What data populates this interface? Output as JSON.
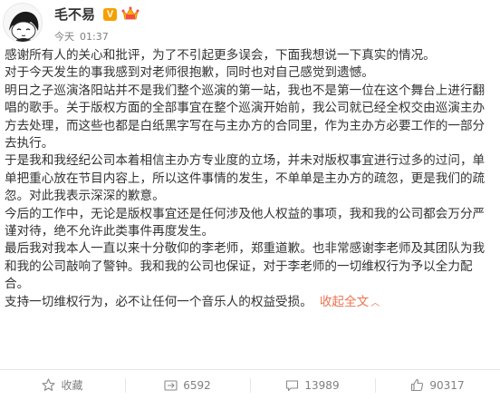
{
  "post": {
    "username": "毛不易",
    "verified_badge": "V",
    "meta": {
      "date": "今天",
      "time": "01:37"
    },
    "paragraphs": [
      "感谢所有人的关心和批评，为了不引起更多误会，下面我想说一下真实的情况。\n对于今天发生的事我感到对老师很抱歉，同时也对自己感觉到遗憾。",
      "明日之子巡演洛阳站并不是我们整个巡演的第一站，我也不是第一位在这个舞台上进行翻唱的歌手。关于版权方面的全部事宜在整个巡演开始前，我公司就已经全权交由巡演主办方去处理，而这些也都是白纸黑字写在与主办方的合同里，作为主办方必要工作的一部分去执行。",
      "于是我和我经纪公司本着相信主办方专业度的立场，并未对版权事宜进行过多的过问，单单把重心放在节目内容上，所以这件事情的发生，不单单是主办方的疏忽，更是我们的疏忽。对此我表示深深的歉意。",
      "今后的工作中，无论是版权事宜还是任何涉及他人权益的事项，我和我的公司都会万分严谨对待，绝不允许此类事件再度发生。",
      "最后我对我本人一直以来十分敬仰的李老师，郑重道歉。也非常感谢李老师及其团队为我和我的公司敲响了警钟。我和我的公司也保证，对于李老师的一切维权行为予以全力配合。"
    ],
    "last_line": "支持一切维权行为，必不让任何一个音乐人的权益受损。",
    "collapse_label": "收起全文",
    "collapse_arrow": "︿"
  },
  "actions": {
    "favorite": {
      "icon": "star-icon",
      "label": "收藏"
    },
    "repost": {
      "icon": "repost-icon",
      "count": "6592"
    },
    "comment": {
      "icon": "comment-icon",
      "count": "13989"
    },
    "like": {
      "icon": "thumbs-up-icon",
      "count": "90317"
    }
  },
  "colors": {
    "text": "#333333",
    "meta": "#808080",
    "link": "#eb7350",
    "badge": "#f6a000",
    "divider": "#e6e6e6"
  }
}
